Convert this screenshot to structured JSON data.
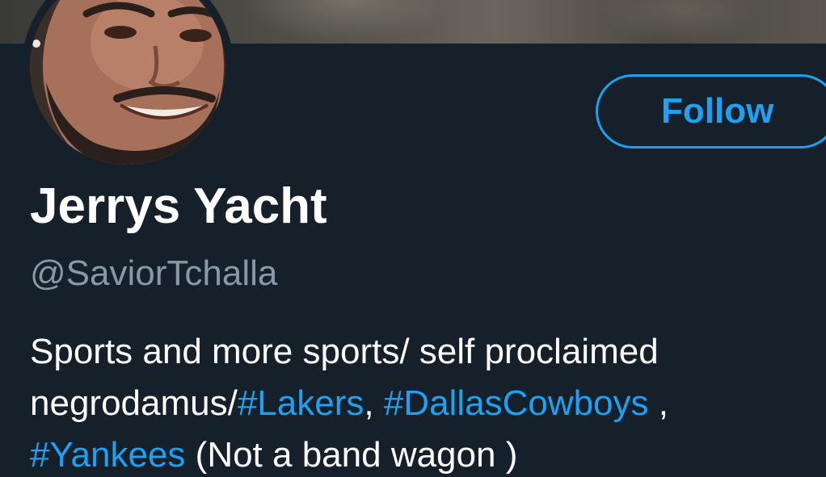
{
  "profile": {
    "display_name": "Jerrys Yacht",
    "handle": "@SaviorTchalla",
    "follow_label": "Follow",
    "bio": {
      "line1": "Sports and more sports/ self proclaimed",
      "line2_prefix": "negrodamus/",
      "hashtag_lakers": "#Lakers",
      "sep1": ", ",
      "hashtag_cowboys": "#DallasCowboys",
      "sep2": " ,",
      "hashtag_yankees": "#Yankees",
      "line3_suffix": " (Not a band wagon )"
    }
  },
  "colors": {
    "background": "#15202b",
    "accent": "#1da1f2",
    "secondary_text": "#8899a6",
    "primary_text": "#ffffff"
  }
}
